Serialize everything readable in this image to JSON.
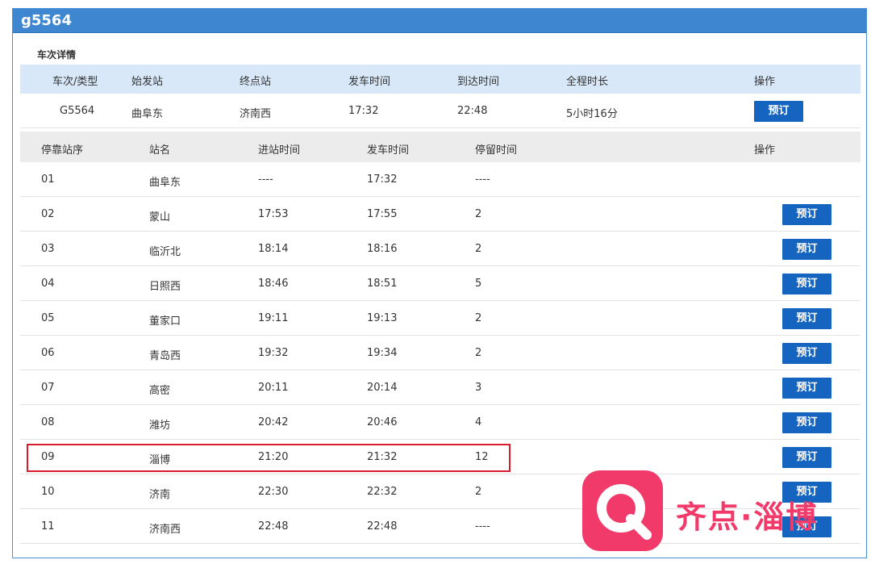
{
  "panel": {
    "title": "g5564",
    "section_title": "车次详情"
  },
  "summary": {
    "headers": [
      "车次/类型",
      "始发站",
      "终点站",
      "发车时间",
      "到达时间",
      "全程时长",
      "操作"
    ],
    "row": {
      "train": "G5564",
      "origin": "曲阜东",
      "destination": "济南西",
      "depart": "17:32",
      "arrive": "22:48",
      "duration": "5小时16分",
      "action": "预订"
    }
  },
  "stops": {
    "headers": [
      "停靠站序",
      "站名",
      "进站时间",
      "发车时间",
      "停留时间",
      "操作"
    ],
    "rows": [
      {
        "seq": "01",
        "name": "曲阜东",
        "arrive": "----",
        "depart": "17:32",
        "stay": "----",
        "action": ""
      },
      {
        "seq": "02",
        "name": "蒙山",
        "arrive": "17:53",
        "depart": "17:55",
        "stay": "2",
        "action": "预订"
      },
      {
        "seq": "03",
        "name": "临沂北",
        "arrive": "18:14",
        "depart": "18:16",
        "stay": "2",
        "action": "预订"
      },
      {
        "seq": "04",
        "name": "日照西",
        "arrive": "18:46",
        "depart": "18:51",
        "stay": "5",
        "action": "预订"
      },
      {
        "seq": "05",
        "name": "董家口",
        "arrive": "19:11",
        "depart": "19:13",
        "stay": "2",
        "action": "预订"
      },
      {
        "seq": "06",
        "name": "青岛西",
        "arrive": "19:32",
        "depart": "19:34",
        "stay": "2",
        "action": "预订"
      },
      {
        "seq": "07",
        "name": "高密",
        "arrive": "20:11",
        "depart": "20:14",
        "stay": "3",
        "action": "预订"
      },
      {
        "seq": "08",
        "name": "潍坊",
        "arrive": "20:42",
        "depart": "20:46",
        "stay": "4",
        "action": "预订"
      },
      {
        "seq": "09",
        "name": "淄博",
        "arrive": "21:20",
        "depart": "21:32",
        "stay": "12",
        "action": "预订"
      },
      {
        "seq": "10",
        "name": "济南",
        "arrive": "22:30",
        "depart": "22:32",
        "stay": "2",
        "action": "预订"
      },
      {
        "seq": "11",
        "name": "济南西",
        "arrive": "22:48",
        "depart": "22:48",
        "stay": "----",
        "action": "预订"
      }
    ]
  },
  "watermark": {
    "text": "齐点·淄博",
    "logo_icon": "q-logo-icon",
    "color": "#f23a6a"
  },
  "colors": {
    "header_blue": "#3e86d0",
    "button_blue": "#1565c0",
    "highlight_red": "#d81e2c"
  }
}
